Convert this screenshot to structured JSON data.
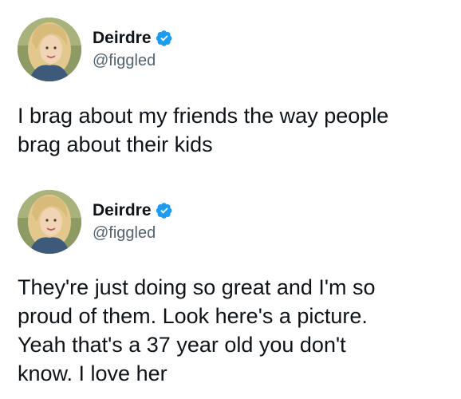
{
  "tweets": [
    {
      "author": {
        "display_name": "Deirdre",
        "handle": "@figgled",
        "verified": true,
        "avatar_icon": "profile-photo"
      },
      "text": "I brag about my friends the way people\nbrag about their kids"
    },
    {
      "author": {
        "display_name": "Deirdre",
        "handle": "@figgled",
        "verified": true,
        "avatar_icon": "profile-photo"
      },
      "text": "They're just doing so great and I'm so\nproud of them. Look here's a picture.\nYeah that's a 37 year old you don't\nknow. I love her"
    }
  ],
  "colors": {
    "verified_badge": "#1d9bf0",
    "handle": "#536471",
    "text": "#0f1419",
    "background": "#ffffff"
  }
}
